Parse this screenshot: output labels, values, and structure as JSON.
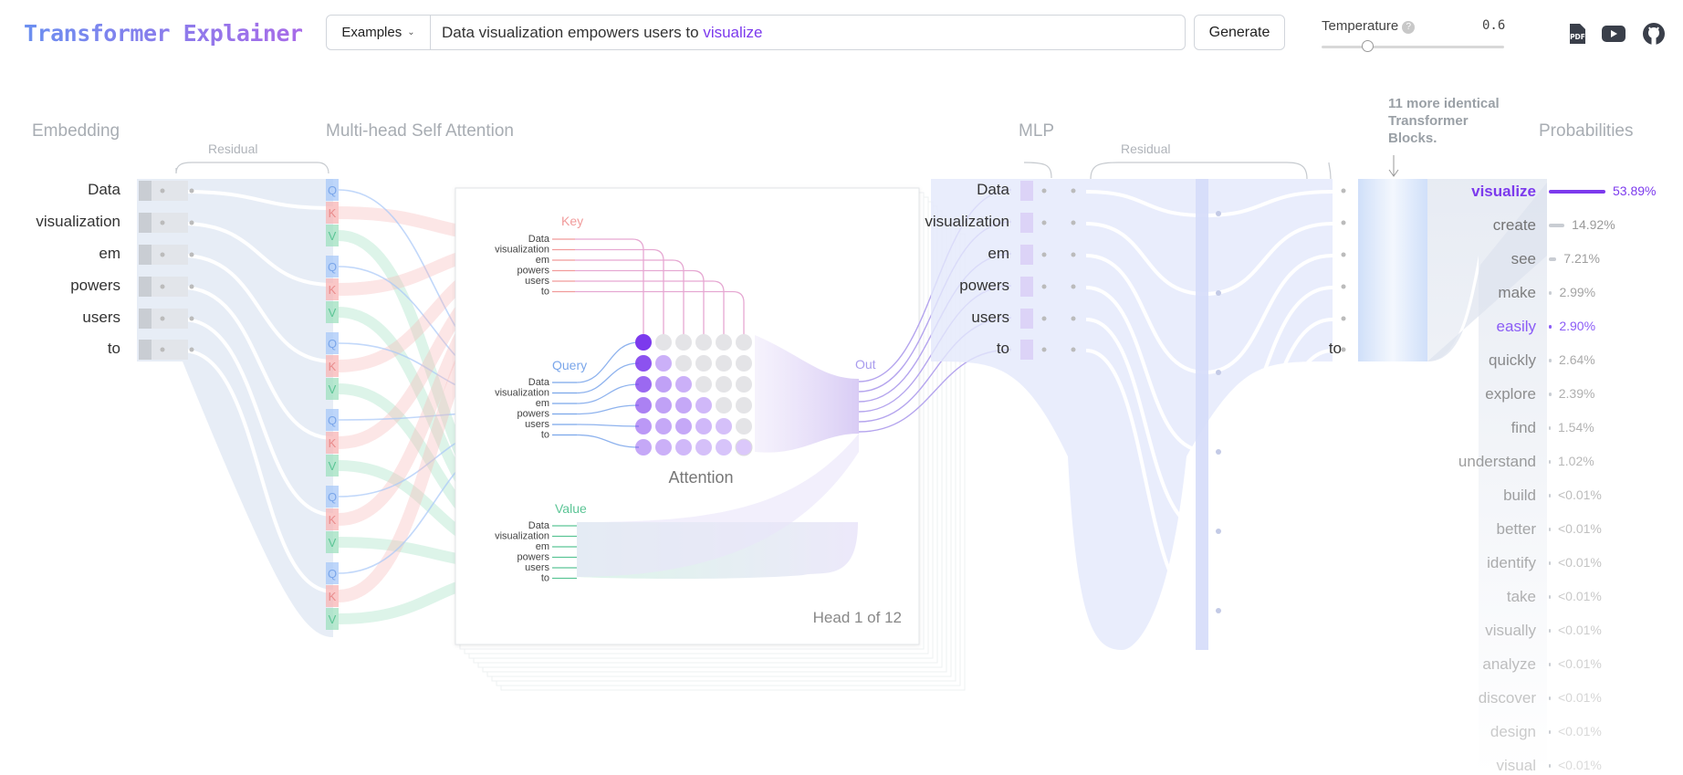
{
  "app": {
    "title": "Transformer Explainer"
  },
  "input": {
    "examples_label": "Examples",
    "prompt_text": "Data visualization empowers users to",
    "prompt_next": "visualize"
  },
  "toolbar": {
    "generate_label": "Generate",
    "temperature_label": "Temperature",
    "temperature_help": "?",
    "temperature_value": "0.6",
    "temperature_fraction": 0.25
  },
  "links": [
    {
      "icon": "pdf-icon"
    },
    {
      "icon": "youtube-icon"
    },
    {
      "icon": "github-icon"
    }
  ],
  "sections": {
    "embedding": "Embedding",
    "attention": "Multi-head Self Attention",
    "mlp": "MLP",
    "probabilities": "Probabilities",
    "residual": "Residual"
  },
  "note": "11 more identical Transformer Blocks.",
  "tokens": [
    "Data",
    "visualization",
    "em",
    "powers",
    "users",
    "to"
  ],
  "attention": {
    "key_label": "Key",
    "query_label": "Query",
    "value_label": "Value",
    "out_label": "Out",
    "caption": "Attention",
    "head_label": "Head 1 of 12",
    "qkv_labels": [
      "Q",
      "K",
      "V"
    ]
  },
  "predictions": [
    {
      "word": "visualize",
      "pct": "53.89%",
      "value": 53.89,
      "selected": true
    },
    {
      "word": "create",
      "pct": "14.92%",
      "value": 14.92
    },
    {
      "word": "see",
      "pct": "7.21%",
      "value": 7.21
    },
    {
      "word": "make",
      "pct": "2.99%",
      "value": 2.99
    },
    {
      "word": "easily",
      "pct": "2.90%",
      "value": 2.9,
      "highlight": true
    },
    {
      "word": "quickly",
      "pct": "2.64%",
      "value": 2.64
    },
    {
      "word": "explore",
      "pct": "2.39%",
      "value": 2.39
    },
    {
      "word": "find",
      "pct": "1.54%",
      "value": 1.54
    },
    {
      "word": "understand",
      "pct": "1.02%",
      "value": 1.02
    },
    {
      "word": "build",
      "pct": "<0.01%",
      "value": 0.01
    },
    {
      "word": "better",
      "pct": "<0.01%",
      "value": 0.01
    },
    {
      "word": "identify",
      "pct": "<0.01%",
      "value": 0.01
    },
    {
      "word": "take",
      "pct": "<0.01%",
      "value": 0.01
    },
    {
      "word": "visually",
      "pct": "<0.01%",
      "value": 0.01
    },
    {
      "word": "analyze",
      "pct": "<0.01%",
      "value": 0.01
    },
    {
      "word": "discover",
      "pct": "<0.01%",
      "value": 0.01
    },
    {
      "word": "design",
      "pct": "<0.01%",
      "value": 0.01
    },
    {
      "word": "visual",
      "pct": "<0.01%",
      "value": 0.01
    }
  ],
  "colors": {
    "accent": "#7c3aed",
    "query": "#a8c8f8",
    "key": "#f8b4b4",
    "value": "#9fe0bf",
    "embed": "#c9d6ec",
    "mlp": "#dfe5fb"
  }
}
